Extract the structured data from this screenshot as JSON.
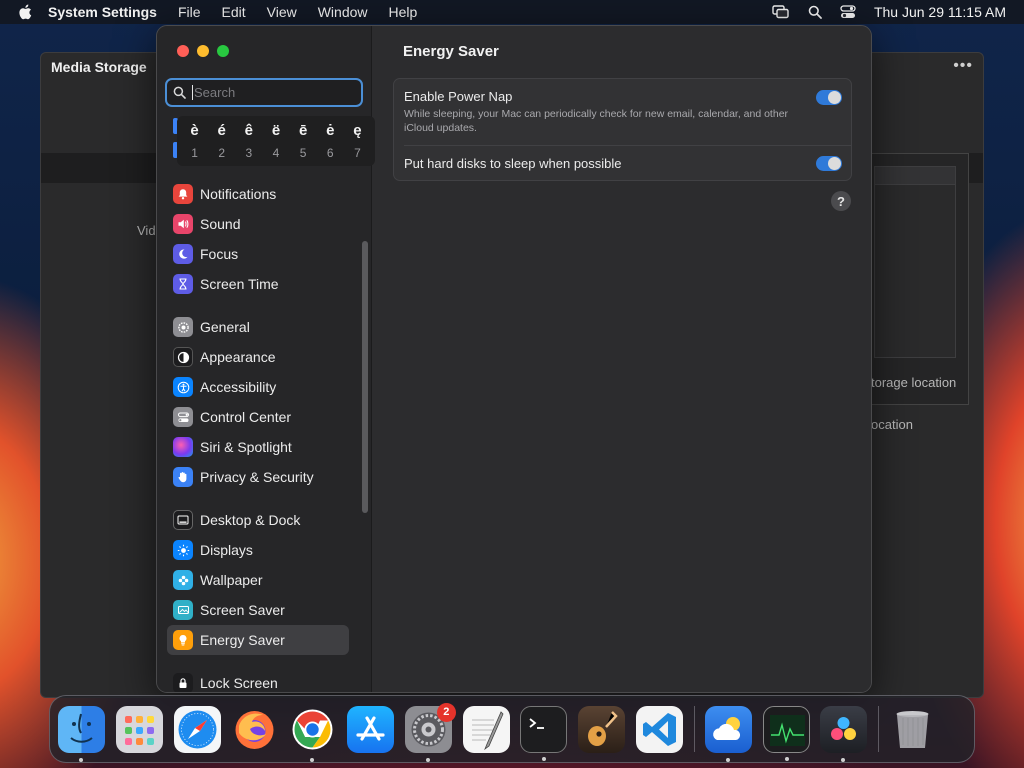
{
  "menubar": {
    "app_name": "System Settings",
    "menus": [
      "File",
      "Edit",
      "View",
      "Window",
      "Help"
    ],
    "clock": "Thu Jun 29  11:15 AM"
  },
  "background_window": {
    "title": "Media Storage",
    "fragments": [
      "Vid",
      "torage location",
      "ocation"
    ]
  },
  "search": {
    "placeholder": "Search",
    "value": ""
  },
  "accent_popup": {
    "chars": [
      "è",
      "é",
      "ê",
      "ë",
      "ē",
      "ė",
      "ę"
    ],
    "numbers": [
      "1",
      "2",
      "3",
      "4",
      "5",
      "6",
      "7"
    ]
  },
  "sidebar": {
    "groups": [
      [
        {
          "label": "Notifications",
          "icon": "bell-icon",
          "color": "#e8453c"
        },
        {
          "label": "Sound",
          "icon": "speaker-icon",
          "color": "#e8456a"
        },
        {
          "label": "Focus",
          "icon": "moon-icon",
          "color": "#5e5ce6"
        },
        {
          "label": "Screen Time",
          "icon": "hourglass-icon",
          "color": "#5e5ce6"
        }
      ],
      [
        {
          "label": "General",
          "icon": "gear-icon",
          "color": "#8e8e93"
        },
        {
          "label": "Appearance",
          "icon": "appearance-icon",
          "color": "#1c1c1e"
        },
        {
          "label": "Accessibility",
          "icon": "accessibility-icon",
          "color": "#0a84ff"
        },
        {
          "label": "Control Center",
          "icon": "control-center-icon",
          "color": "#8e8e93"
        },
        {
          "label": "Siri & Spotlight",
          "icon": "siri-icon",
          "color": "#b23af0"
        },
        {
          "label": "Privacy & Security",
          "icon": "hand-icon",
          "color": "#3b82f6"
        }
      ],
      [
        {
          "label": "Desktop & Dock",
          "icon": "dock-icon",
          "color": "#1c1c1e"
        },
        {
          "label": "Displays",
          "icon": "sun-icon",
          "color": "#0a84ff"
        },
        {
          "label": "Wallpaper",
          "icon": "flower-icon",
          "color": "#30b0e6"
        },
        {
          "label": "Screen Saver",
          "icon": "screen-saver-icon",
          "color": "#30b0c7"
        },
        {
          "label": "Energy Saver",
          "icon": "bulb-icon",
          "color": "#ff9f0a",
          "selected": true
        }
      ],
      [
        {
          "label": "Lock Screen",
          "icon": "lock-icon",
          "color": "#1c1c1e"
        }
      ]
    ]
  },
  "content": {
    "title": "Energy Saver",
    "power_nap": {
      "label": "Enable Power Nap",
      "description": "While sleeping, your Mac can periodically check for new email, calendar, and other iCloud updates.",
      "enabled": true
    },
    "hard_disk_sleep": {
      "label": "Put hard disks to sleep when possible",
      "enabled": true
    },
    "help_label": "?"
  },
  "dock": {
    "apps": [
      {
        "name": "Finder",
        "icon": "finder-icon",
        "running": true
      },
      {
        "name": "Launchpad",
        "icon": "launchpad-icon",
        "running": false
      },
      {
        "name": "Safari",
        "icon": "safari-icon",
        "running": false
      },
      {
        "name": "Firefox",
        "icon": "firefox-icon",
        "running": false
      },
      {
        "name": "Chrome",
        "icon": "chrome-icon",
        "running": true
      },
      {
        "name": "App Store",
        "icon": "app-store-icon",
        "running": false
      },
      {
        "name": "System Settings",
        "icon": "system-settings-icon",
        "running": true,
        "badge": "2"
      },
      {
        "name": "TextEdit",
        "icon": "textedit-icon",
        "running": false
      },
      {
        "name": "Terminal",
        "icon": "terminal-icon",
        "running": true
      },
      {
        "name": "GarageBand",
        "icon": "garageband-icon",
        "running": false
      },
      {
        "name": "VS Code",
        "icon": "vscode-icon",
        "running": false
      }
    ],
    "recent": [
      {
        "name": "Weather",
        "icon": "weather-icon",
        "running": true
      },
      {
        "name": "Activity Monitor",
        "icon": "activity-monitor-icon",
        "running": true
      },
      {
        "name": "DaVinci Resolve",
        "icon": "davinci-resolve-icon",
        "running": true
      }
    ],
    "trash": {
      "name": "Trash",
      "icon": "trash-icon"
    }
  }
}
